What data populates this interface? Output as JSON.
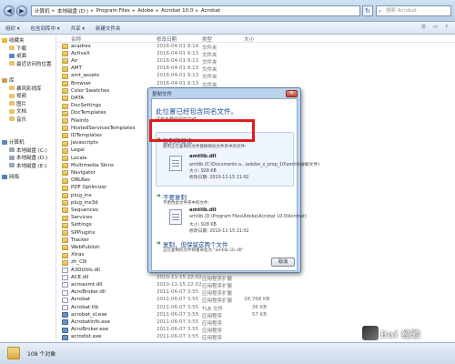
{
  "titlebar": {
    "crumbs": [
      "计算机",
      "本地磁盘 (D:)",
      "Program Files",
      "Adobe",
      "Acrobat 10.0",
      "Acrobat"
    ],
    "search_placeholder": "搜索 Acrobat"
  },
  "toolbar": {
    "organize": "组织 ▾",
    "include_library": "包含到库中 ▾",
    "share": "共享 ▾",
    "new_folder": "新建文件夹"
  },
  "navpane": {
    "favorites": "收藏夹",
    "favorites_items": [
      "下载",
      "桌面",
      "最近访问的位置"
    ],
    "libraries": "库",
    "libraries_items": [
      "暴风影视库",
      "视频",
      "图片",
      "文档",
      "音乐"
    ],
    "computer": "计算机",
    "computer_items": [
      "本地磁盘 (C:)",
      "本地磁盘 (D:)",
      "本地磁盘 (E:)"
    ],
    "network": "网络"
  },
  "filelist": {
    "headers": {
      "name": "名称",
      "date": "修改日期",
      "type": "类型",
      "size": "大小"
    },
    "rows": [
      {
        "name": "acadres",
        "date": "2016-04-01 9:14",
        "type": "文件夹",
        "size": "",
        "kind": "folder"
      },
      {
        "name": "ActiveX",
        "date": "2016-04-01 9:13",
        "type": "文件夹",
        "size": "",
        "kind": "folder"
      },
      {
        "name": "Air",
        "date": "2016-04-01 9:13",
        "type": "文件夹",
        "size": "",
        "kind": "folder"
      },
      {
        "name": "AMT",
        "date": "2016-04-01 9:13",
        "type": "文件夹",
        "size": "",
        "kind": "folder"
      },
      {
        "name": "amt_assets",
        "date": "2016-04-01 9:13",
        "type": "文件夹",
        "size": "",
        "kind": "folder"
      },
      {
        "name": "Browser",
        "date": "2016-04-01 9:13",
        "type": "文件夹",
        "size": "",
        "kind": "folder"
      },
      {
        "name": "Color Swatches",
        "date": "2016-04-01 9:13",
        "type": "文件夹",
        "size": "",
        "kind": "folder"
      },
      {
        "name": "DATA",
        "date": "",
        "type": "",
        "size": "",
        "kind": "folder"
      },
      {
        "name": "DocSettings",
        "date": "",
        "type": "",
        "size": "",
        "kind": "folder"
      },
      {
        "name": "DocTemplates",
        "date": "",
        "type": "",
        "size": "",
        "kind": "folder"
      },
      {
        "name": "FileInfo",
        "date": "",
        "type": "",
        "size": "",
        "kind": "folder"
      },
      {
        "name": "HostedServicesTemplates",
        "date": "",
        "type": "",
        "size": "",
        "kind": "folder"
      },
      {
        "name": "IDTemplates",
        "date": "",
        "type": "",
        "size": "",
        "kind": "folder"
      },
      {
        "name": "Javascripts",
        "date": "",
        "type": "",
        "size": "",
        "kind": "folder"
      },
      {
        "name": "Legal",
        "date": "",
        "type": "",
        "size": "",
        "kind": "folder"
      },
      {
        "name": "Locale",
        "date": "",
        "type": "",
        "size": "",
        "kind": "folder"
      },
      {
        "name": "Multimedia Skins",
        "date": "",
        "type": "",
        "size": "",
        "kind": "folder"
      },
      {
        "name": "Navigator",
        "date": "",
        "type": "",
        "size": "",
        "kind": "folder"
      },
      {
        "name": "OBLRes",
        "date": "",
        "type": "",
        "size": "",
        "kind": "folder"
      },
      {
        "name": "PDF Optimizer",
        "date": "",
        "type": "",
        "size": "",
        "kind": "folder"
      },
      {
        "name": "plug_ins",
        "date": "",
        "type": "",
        "size": "",
        "kind": "folder"
      },
      {
        "name": "plug_ins3d",
        "date": "",
        "type": "",
        "size": "",
        "kind": "folder"
      },
      {
        "name": "Sequences",
        "date": "",
        "type": "",
        "size": "",
        "kind": "folder"
      },
      {
        "name": "Services",
        "date": "",
        "type": "",
        "size": "",
        "kind": "folder"
      },
      {
        "name": "Settings",
        "date": "",
        "type": "",
        "size": "",
        "kind": "folder"
      },
      {
        "name": "SPPlugins",
        "date": "",
        "type": "",
        "size": "",
        "kind": "folder"
      },
      {
        "name": "Tracker",
        "date": "",
        "type": "",
        "size": "",
        "kind": "folder"
      },
      {
        "name": "WebPublish",
        "date": "",
        "type": "",
        "size": "",
        "kind": "folder"
      },
      {
        "name": "Xtras",
        "date": "",
        "type": "",
        "size": "",
        "kind": "folder"
      },
      {
        "name": "zh_CN",
        "date": "",
        "type": "",
        "size": "",
        "kind": "folder"
      },
      {
        "name": "A3DUtils.dll",
        "date": "",
        "type": "",
        "size": "",
        "kind": "file"
      },
      {
        "name": "ACE.dll",
        "date": "2010-11-15 22:02",
        "type": "应用程序扩展",
        "size": "",
        "kind": "file"
      },
      {
        "name": "acroaxmt.dll",
        "date": "2010-11-15 22:02",
        "type": "应用程序扩展",
        "size": "",
        "kind": "file"
      },
      {
        "name": "AcroBroker.dll",
        "date": "2011-06-07 3:55",
        "type": "应用程序扩展",
        "size": "",
        "kind": "file"
      },
      {
        "name": "Acrobat",
        "date": "2011-06-07 3:55",
        "type": "应用程序扩展",
        "size": "28,768 KB",
        "kind": "file"
      },
      {
        "name": "Acrobat.tlb",
        "date": "2011-06-07 3:55",
        "type": "TLB 文件",
        "size": "36 KB",
        "kind": "file"
      },
      {
        "name": "acrobat_sl.exe",
        "date": "2011-06-07 3:55",
        "type": "应用程序",
        "size": "57 KB",
        "kind": "exe"
      },
      {
        "name": "AcrobatInfo.exe",
        "date": "2011-06-07 3:55",
        "type": "应用程序",
        "size": "",
        "kind": "exe"
      },
      {
        "name": "AcroBroker.exe",
        "date": "2011-06-07 3:55",
        "type": "应用程序",
        "size": "",
        "kind": "exe"
      },
      {
        "name": "acrodist.exe",
        "date": "2011-06-07 3:55",
        "type": "应用程序",
        "size": "",
        "kind": "exe"
      }
    ]
  },
  "status": {
    "count_text": "108 个对象"
  },
  "dialog": {
    "title": "复制文件",
    "heading": "此位置已经包含同名文件。",
    "subheading": "请单击要保留的文件",
    "option1": {
      "title": "复制和替换",
      "desc": "使用正在复制的文件替换目标文件夹中的文件:",
      "file_name": "amtlib.dll",
      "file_path": "amtlib (C:\\Documents a...\\adobe_x_prop_10\\amtlib破解文件)",
      "file_size": "大小: 928 KB",
      "file_modified": "修改日期: 2010-11-15 21:02"
    },
    "option2": {
      "title": "不要复制",
      "desc": "不更改此文件夹中的文件:",
      "file_name": "amtlib.dll",
      "file_path": "amtlib (D:\\Program Files\\Adobe\\Acrobat 10.0\\Acrobat)",
      "file_size": "大小: 928 KB",
      "file_modified": "修改日期: 2010-11-15 21:02"
    },
    "option3": {
      "title": "复制，但保留这两个文件",
      "desc": "正在复制的文件将重命名为 \"amtlib (2).dll\""
    },
    "cancel_label": "取消"
  },
  "watermark": {
    "text": "Bai 经验"
  },
  "colors": {
    "highlight": "#e41b1b",
    "link_blue": "#17498b",
    "green_arrow": "#2b8a2b"
  }
}
